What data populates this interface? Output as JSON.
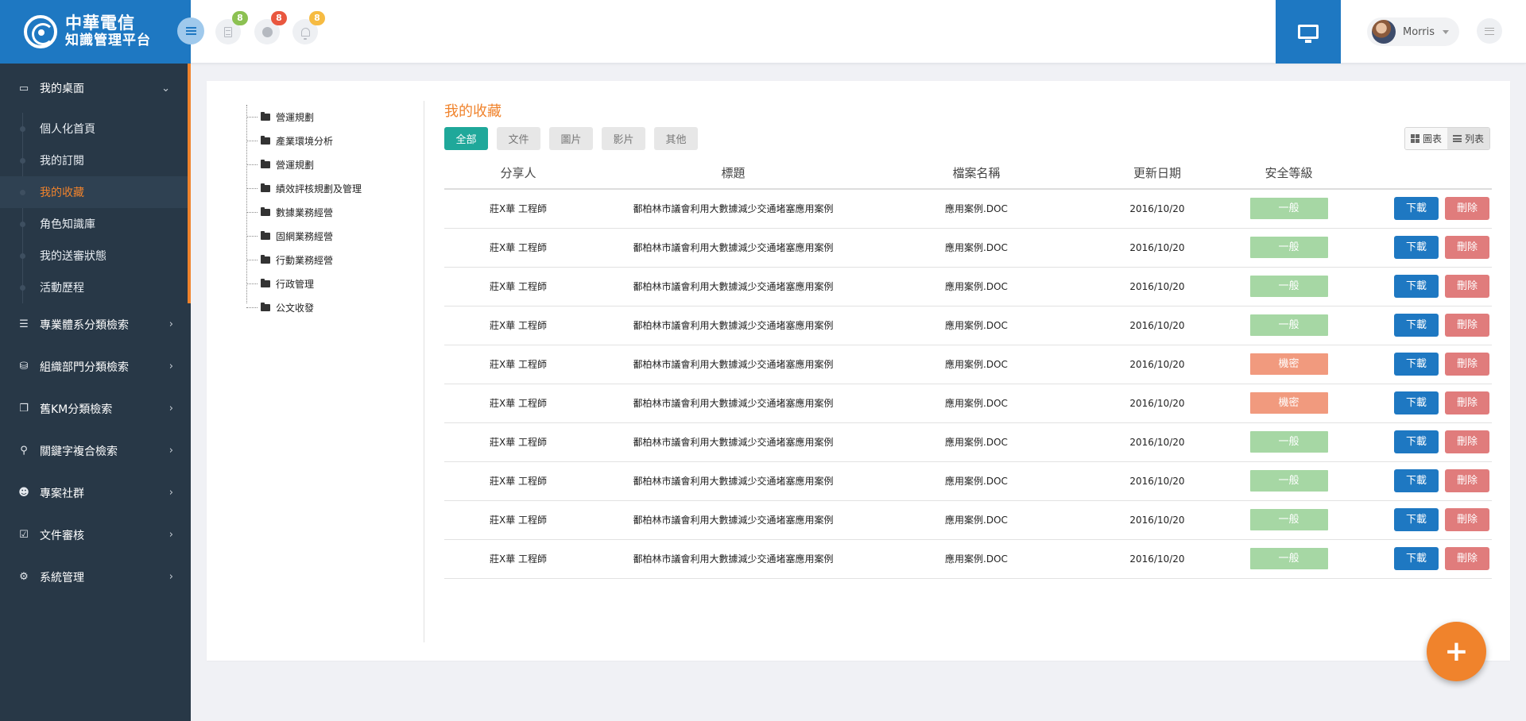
{
  "brand": {
    "line1": "中華電信",
    "line2": "知識管理平台"
  },
  "header": {
    "notifications": [
      {
        "icon": "document-icon",
        "count": "8",
        "color": "#8cc152"
      },
      {
        "icon": "globe-icon",
        "count": "8",
        "color": "#e9573f"
      },
      {
        "icon": "bell-icon",
        "count": "8",
        "color": "#f6bb42"
      }
    ],
    "user": {
      "name": "Morris"
    }
  },
  "sidebar": {
    "desk": {
      "label": "我的桌面",
      "items": [
        {
          "label": "個人化首頁",
          "active": false
        },
        {
          "label": "我的訂閱",
          "active": false
        },
        {
          "label": "我的收藏",
          "active": true
        },
        {
          "label": "角色知識庫",
          "active": false
        },
        {
          "label": "我的送審狀態",
          "active": false
        },
        {
          "label": "活動歷程",
          "active": false
        }
      ]
    },
    "items": [
      {
        "label": "專業體系分類檢索",
        "icon": "list-icon"
      },
      {
        "label": "組織部門分類檢索",
        "icon": "sitemap-icon"
      },
      {
        "label": "舊KM分類檢索",
        "icon": "copy-icon"
      },
      {
        "label": "關鍵字複合檢索",
        "icon": "search-icon"
      },
      {
        "label": "專案社群",
        "icon": "users-icon"
      },
      {
        "label": "文件審核",
        "icon": "check-square-icon"
      },
      {
        "label": "系統管理",
        "icon": "gear-icon"
      }
    ]
  },
  "tree": [
    "營運規劃",
    "產業環境分析",
    "營運規劃",
    "績效評核規劃及管理",
    "數據業務經營",
    "固網業務經營",
    "行動業務經營",
    "行政管理",
    "公文收發"
  ],
  "main": {
    "title": "我的收藏",
    "filters": [
      "全部",
      "文件",
      "圖片",
      "影片",
      "其他"
    ],
    "view": {
      "chart": "圖表",
      "list": "列表"
    },
    "table": {
      "headers": [
        "分享人",
        "標題",
        "檔案名稱",
        "更新日期",
        "安全等級"
      ],
      "rows": [
        {
          "sharer": "莊X華 工程師",
          "title": "鄱柏林市議會利用大數據減少交通堵塞應用案例",
          "file": "應用案例.DOC",
          "date": "2016/10/20",
          "level": "一般",
          "level_color": "green"
        },
        {
          "sharer": "莊X華 工程師",
          "title": "鄱柏林市議會利用大數據減少交通堵塞應用案例",
          "file": "應用案例.DOC",
          "date": "2016/10/20",
          "level": "一般",
          "level_color": "green"
        },
        {
          "sharer": "莊X華 工程師",
          "title": "鄱柏林市議會利用大數據減少交通堵塞應用案例",
          "file": "應用案例.DOC",
          "date": "2016/10/20",
          "level": "一般",
          "level_color": "green"
        },
        {
          "sharer": "莊X華 工程師",
          "title": "鄱柏林市議會利用大數據減少交通堵塞應用案例",
          "file": "應用案例.DOC",
          "date": "2016/10/20",
          "level": "一般",
          "level_color": "green"
        },
        {
          "sharer": "莊X華 工程師",
          "title": "鄱柏林市議會利用大數據減少交通堵塞應用案例",
          "file": "應用案例.DOC",
          "date": "2016/10/20",
          "level": "機密",
          "level_color": "red"
        },
        {
          "sharer": "莊X華 工程師",
          "title": "鄱柏林市議會利用大數據減少交通堵塞應用案例",
          "file": "應用案例.DOC",
          "date": "2016/10/20",
          "level": "機密",
          "level_color": "red"
        },
        {
          "sharer": "莊X華 工程師",
          "title": "鄱柏林市議會利用大數據減少交通堵塞應用案例",
          "file": "應用案例.DOC",
          "date": "2016/10/20",
          "level": "一般",
          "level_color": "green"
        },
        {
          "sharer": "莊X華 工程師",
          "title": "鄱柏林市議會利用大數據減少交通堵塞應用案例",
          "file": "應用案例.DOC",
          "date": "2016/10/20",
          "level": "一般",
          "level_color": "green"
        },
        {
          "sharer": "莊X華 工程師",
          "title": "鄱柏林市議會利用大數據減少交通堵塞應用案例",
          "file": "應用案例.DOC",
          "date": "2016/10/20",
          "level": "一般",
          "level_color": "green"
        },
        {
          "sharer": "莊X華 工程師",
          "title": "鄱柏林市議會利用大數據減少交通堵塞應用案例",
          "file": "應用案例.DOC",
          "date": "2016/10/20",
          "level": "一般",
          "level_color": "green"
        }
      ],
      "actions": {
        "download": "下載",
        "delete": "刪除"
      }
    }
  },
  "fab": {
    "symbol": "+"
  }
}
